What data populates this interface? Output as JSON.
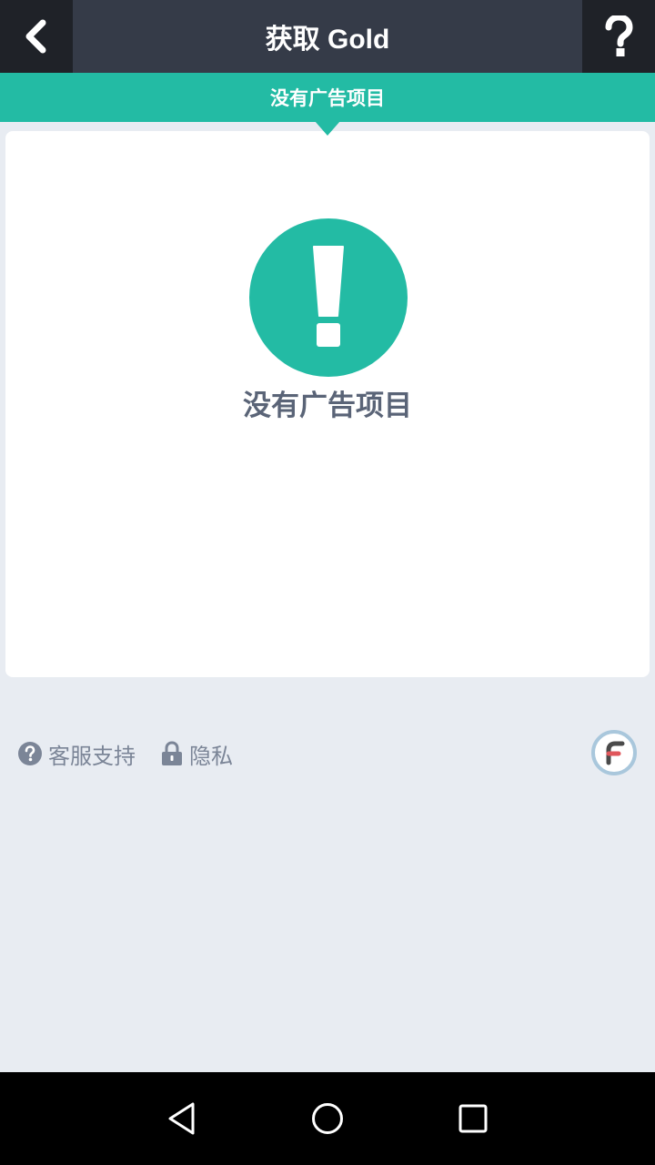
{
  "header": {
    "title": "获取 Gold",
    "back_icon": "chevron-left-icon",
    "help_icon": "question-mark-icon"
  },
  "tab": {
    "label": "没有广告项目"
  },
  "empty_state": {
    "icon": "exclamation-icon",
    "message": "没有广告项目"
  },
  "footer": {
    "support_label": "客服支持",
    "privacy_label": "隐私",
    "support_icon": "question-circle-icon",
    "privacy_icon": "lock-icon",
    "brand_icon": "brand-f-logo-icon"
  },
  "system_nav": {
    "back": "nav-back-icon",
    "home": "nav-home-icon",
    "recent": "nav-recent-icon"
  },
  "colors": {
    "header_bg": "#353b48",
    "header_btn_bg": "#1f2228",
    "accent": "#23bba4",
    "page_bg": "#e8ecf2",
    "text_muted": "#7b8597",
    "text_dark": "#5a6477"
  }
}
